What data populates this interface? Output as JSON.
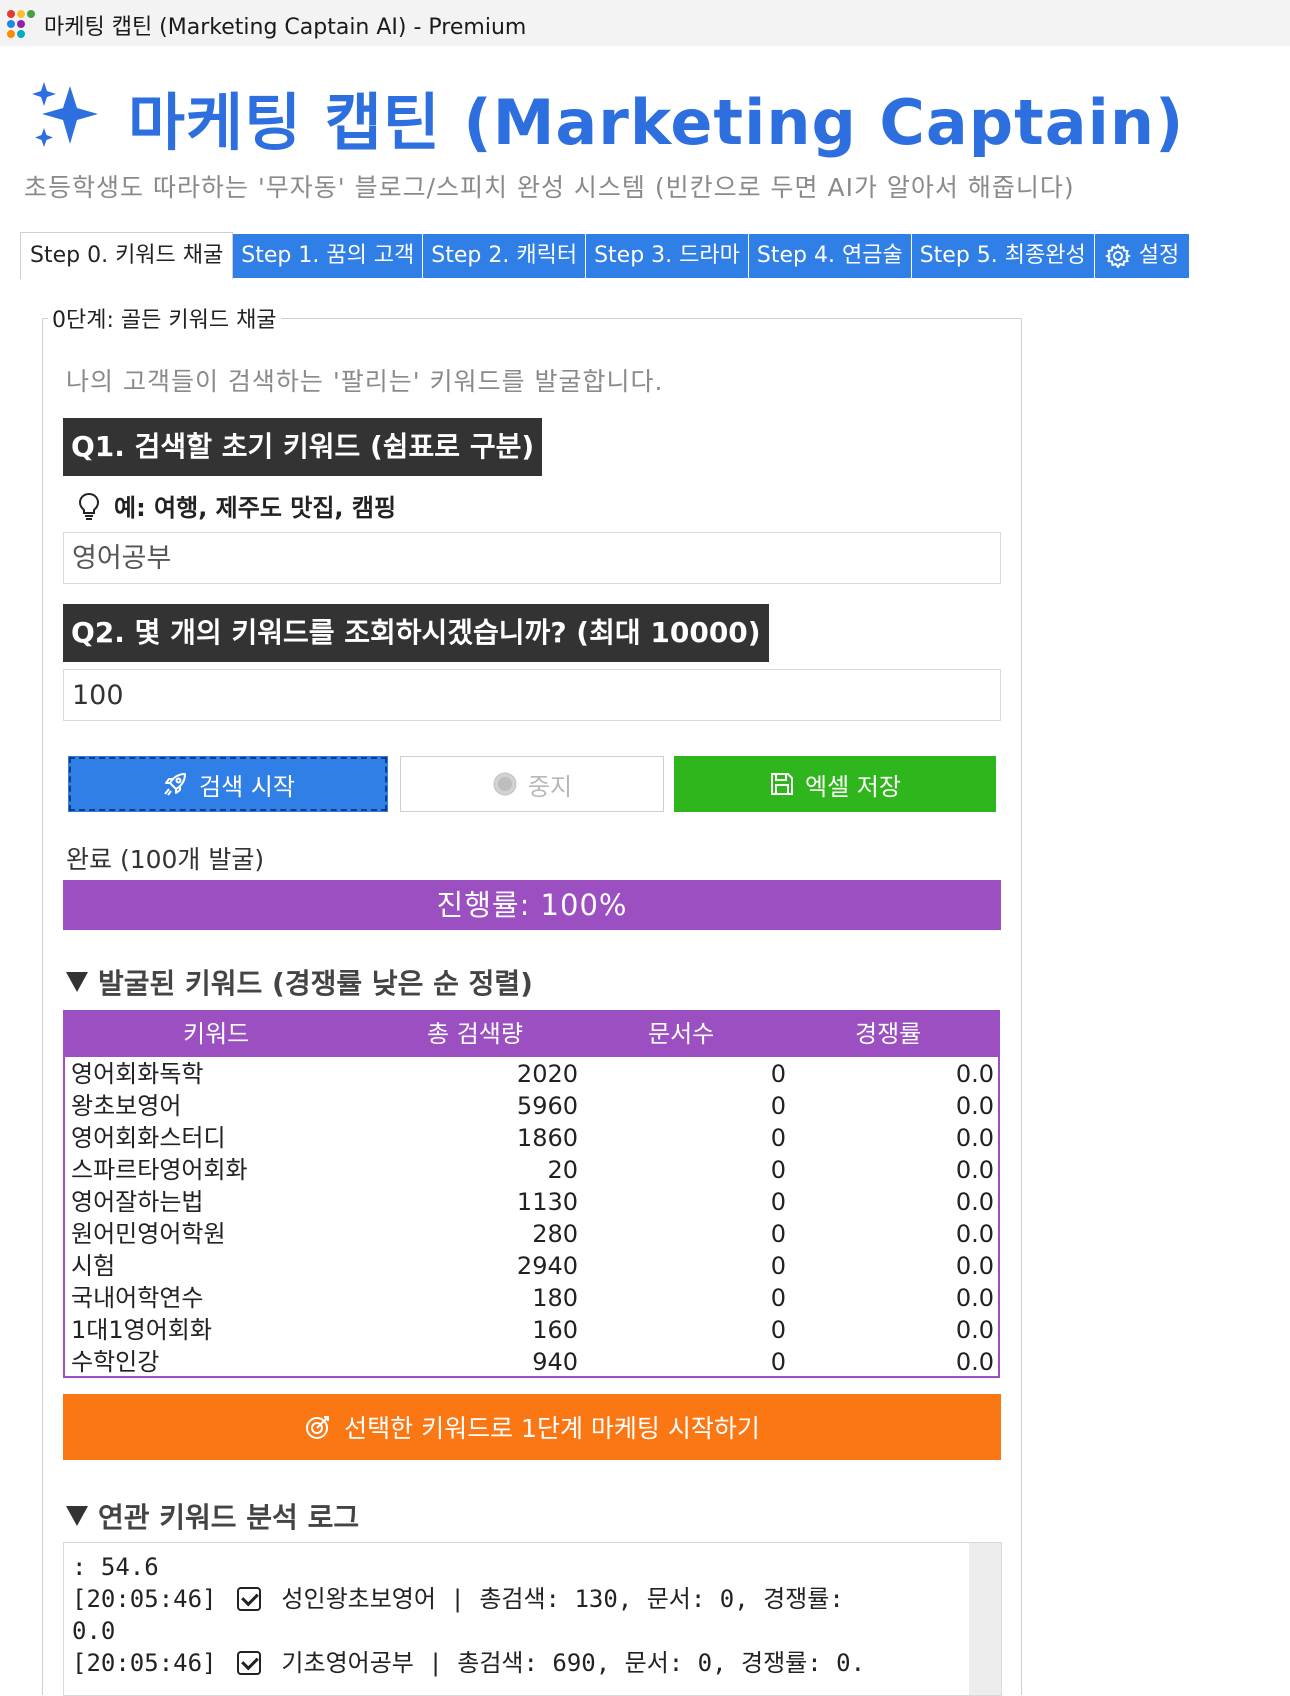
{
  "window": {
    "title": "마케팅 캡틴 (Marketing Captain AI) - Premium"
  },
  "header": {
    "title": "마케팅 캡틴 (Marketing Captain)",
    "subtitle": "초등학생도 따라하는 '무자동' 블로그/스피치 완성 시스템 (빈칸으로 두면 AI가 알아서 해줍니다)"
  },
  "tabs": [
    {
      "label": "Step 0. 키워드 채굴",
      "active": true
    },
    {
      "label": "Step 1. 꿈의 고객"
    },
    {
      "label": "Step 2. 캐릭터"
    },
    {
      "label": "Step 3. 드라마"
    },
    {
      "label": "Step 4. 연금술"
    },
    {
      "label": "Step 5. 최종완성"
    },
    {
      "label": "설정",
      "icon": "gear-icon"
    }
  ],
  "step0": {
    "group_title": "0단계: 골든 키워드 채굴",
    "description": "나의 고객들이 검색하는 '팔리는' 키워드를 발굴합니다.",
    "q1_label": "Q1. 검색할 초기 키워드 (쉼표로 구분)",
    "q1_hint": "예: 여행, 제주도 맛집, 캠핑",
    "q1_value": "영어공부",
    "q2_label": "Q2. 몇 개의 키워드를 조회하시겠습니까? (최대 10000)",
    "q2_value": "100",
    "buttons": {
      "search": "검색 시작",
      "stop": "중지",
      "excel": "엑셀 저장"
    },
    "status": "완료 (100개 발굴)",
    "progress_text": "진행률: 100%",
    "progress_percent": 100,
    "results_title": "발굴된 키워드 (경쟁률 낮은 순 정렬)",
    "table": {
      "columns": [
        "키워드",
        "총 검색량",
        "문서수",
        "경쟁률"
      ],
      "rows": [
        [
          "영어회화독학",
          "2020",
          "0",
          "0.0"
        ],
        [
          "왕초보영어",
          "5960",
          "0",
          "0.0"
        ],
        [
          "영어회화스터디",
          "1860",
          "0",
          "0.0"
        ],
        [
          "스파르타영어회화",
          "20",
          "0",
          "0.0"
        ],
        [
          "영어잘하는법",
          "1130",
          "0",
          "0.0"
        ],
        [
          "원어민영어학원",
          "280",
          "0",
          "0.0"
        ],
        [
          "시험",
          "2940",
          "0",
          "0.0"
        ],
        [
          "국내어학연수",
          "180",
          "0",
          "0.0"
        ],
        [
          "1대1영어회화",
          "160",
          "0",
          "0.0"
        ],
        [
          "수학인강",
          "940",
          "0",
          "0.0"
        ]
      ]
    },
    "start_button": "선택한 키워드로 1단계 마케팅 시작하기",
    "log_title": "연관 키워드 분석 로그",
    "log": [
      {
        "text": ": 54.6"
      },
      {
        "time": "[20:05:46]",
        "text": "성인왕초보영어 | 총검색: 130, 문서: 0, 경쟁률:"
      },
      {
        "text": "0.0"
      },
      {
        "time": "[20:05:46]",
        "text": "기초영어공부 | 총검색: 690, 문서: 0, 경쟁률: 0."
      }
    ]
  },
  "colors": {
    "accent_blue": "#2f7fe6",
    "title_blue": "#2e6fe0",
    "purple": "#9c4fc1",
    "green": "#2fb61c",
    "orange": "#fa7714",
    "label_dark": "#333333"
  }
}
